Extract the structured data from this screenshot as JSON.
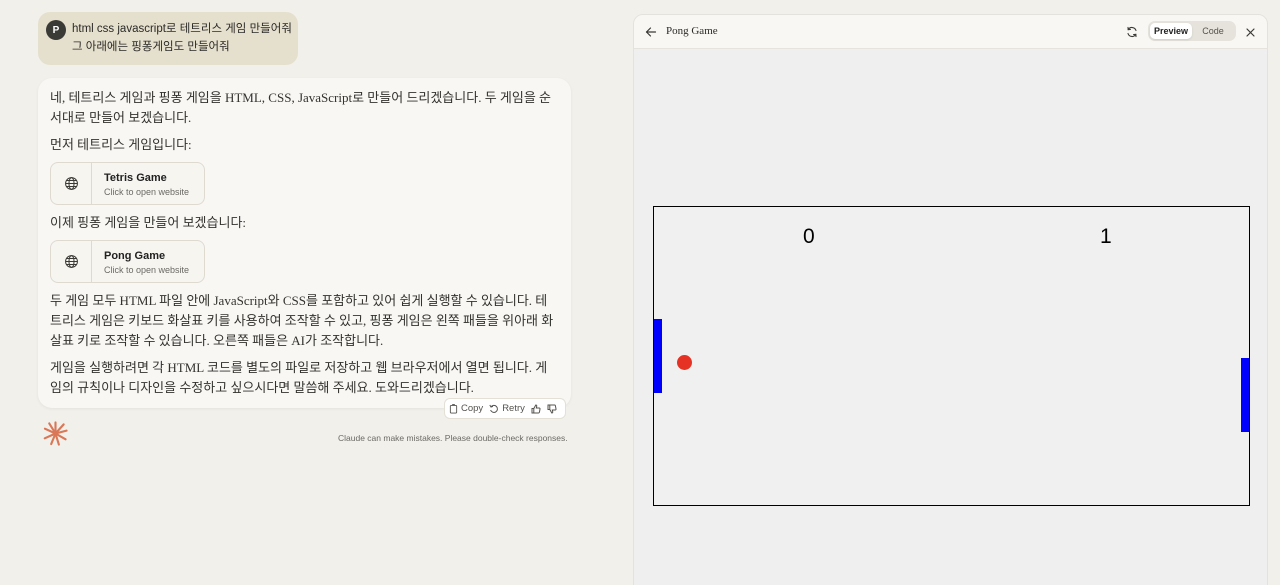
{
  "user_message": {
    "avatar_initial": "P",
    "line1": "html css javascript로 테트리스 게임 만들어줘",
    "line2": "그 아래에는 핑퐁게임도 만들어줘"
  },
  "assistant": {
    "intro": "네, 테트리스 게임과 핑퐁 게임을 HTML, CSS, JavaScript로 만들어 드리겠습니다. 두 게임을 순서대로 만들어 보겠습니다.",
    "tetris_intro": "먼저 테트리스 게임입니다:",
    "tetris_artifact": {
      "name": "Tetris Game",
      "sub": "Click to open website",
      "icon": "globe-icon"
    },
    "pong_intro": "이제 핑퐁 게임을 만들어 보겠습니다:",
    "pong_artifact": {
      "name": "Pong Game",
      "sub": "Click to open website",
      "icon": "globe-icon"
    },
    "body1": "두 게임 모두 HTML 파일 안에 JavaScript와 CSS를 포함하고 있어 쉽게 실행할 수 있습니다. 테트리스 게임은 키보드 화살표 키를 사용하여 조작할 수 있고, 핑퐁 게임은 왼쪽 패들을 위아래 화살표 키로 조작할 수 있습니다. 오른쪽 패들은 AI가 조작합니다.",
    "body2": "게임을 실행하려면 각 HTML 코드를 별도의 파일로 저장하고 웹 브라우저에서 열면 됩니다. 게임의 규칙이나 디자인을 수정하고 싶으시다면 말씀해 주세요. 도와드리겠습니다."
  },
  "actions": {
    "copy": "Copy",
    "retry": "Retry"
  },
  "disclaimer": "Claude can make mistakes. Please double-check responses.",
  "preview": {
    "title": "Pong Game",
    "tabs": {
      "preview": "Preview",
      "code": "Code"
    },
    "active_tab": "preview",
    "game": {
      "score_left": "0",
      "score_right": "1",
      "colors": {
        "paddle": "#0000ff",
        "ball": "#e53224",
        "border": "#000000"
      }
    }
  },
  "colors": {
    "accent": "#d97757",
    "page_bg": "#f2f0ea"
  }
}
